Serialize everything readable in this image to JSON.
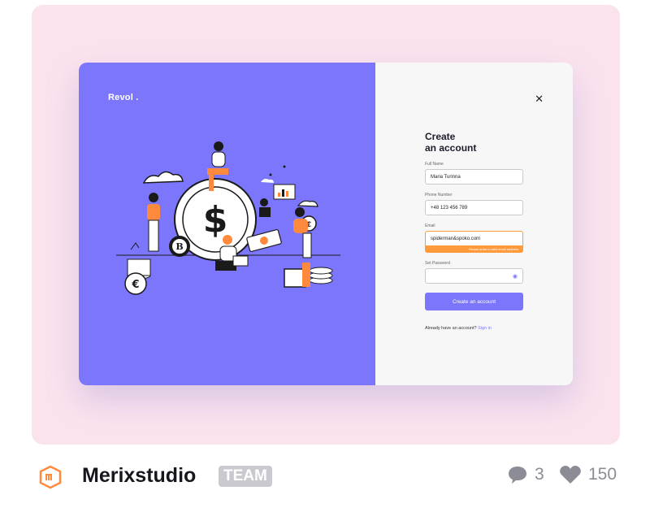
{
  "brand": "Revol .",
  "form": {
    "title_line1": "Create",
    "title_line2": "an account",
    "full_name_label": "Full Name",
    "full_name_value": "Maria Turinna",
    "phone_label": "Phone Number",
    "phone_value": "+48 123 456 789",
    "email_label": "Email",
    "email_value": "spiderman&spoko.com",
    "email_error": "Please enter a valid email address",
    "password_label": "Set Password",
    "submit_label": "Create an account",
    "already_text": "Already have an account?",
    "sign_in_label": "Sign in"
  },
  "footer": {
    "team_name": "Merixstudio",
    "badge": "TEAM",
    "comments": "3",
    "likes": "150"
  },
  "colors": {
    "accent": "#7b76fb",
    "error": "#ff9a3d",
    "background": "#fbe3ee"
  }
}
